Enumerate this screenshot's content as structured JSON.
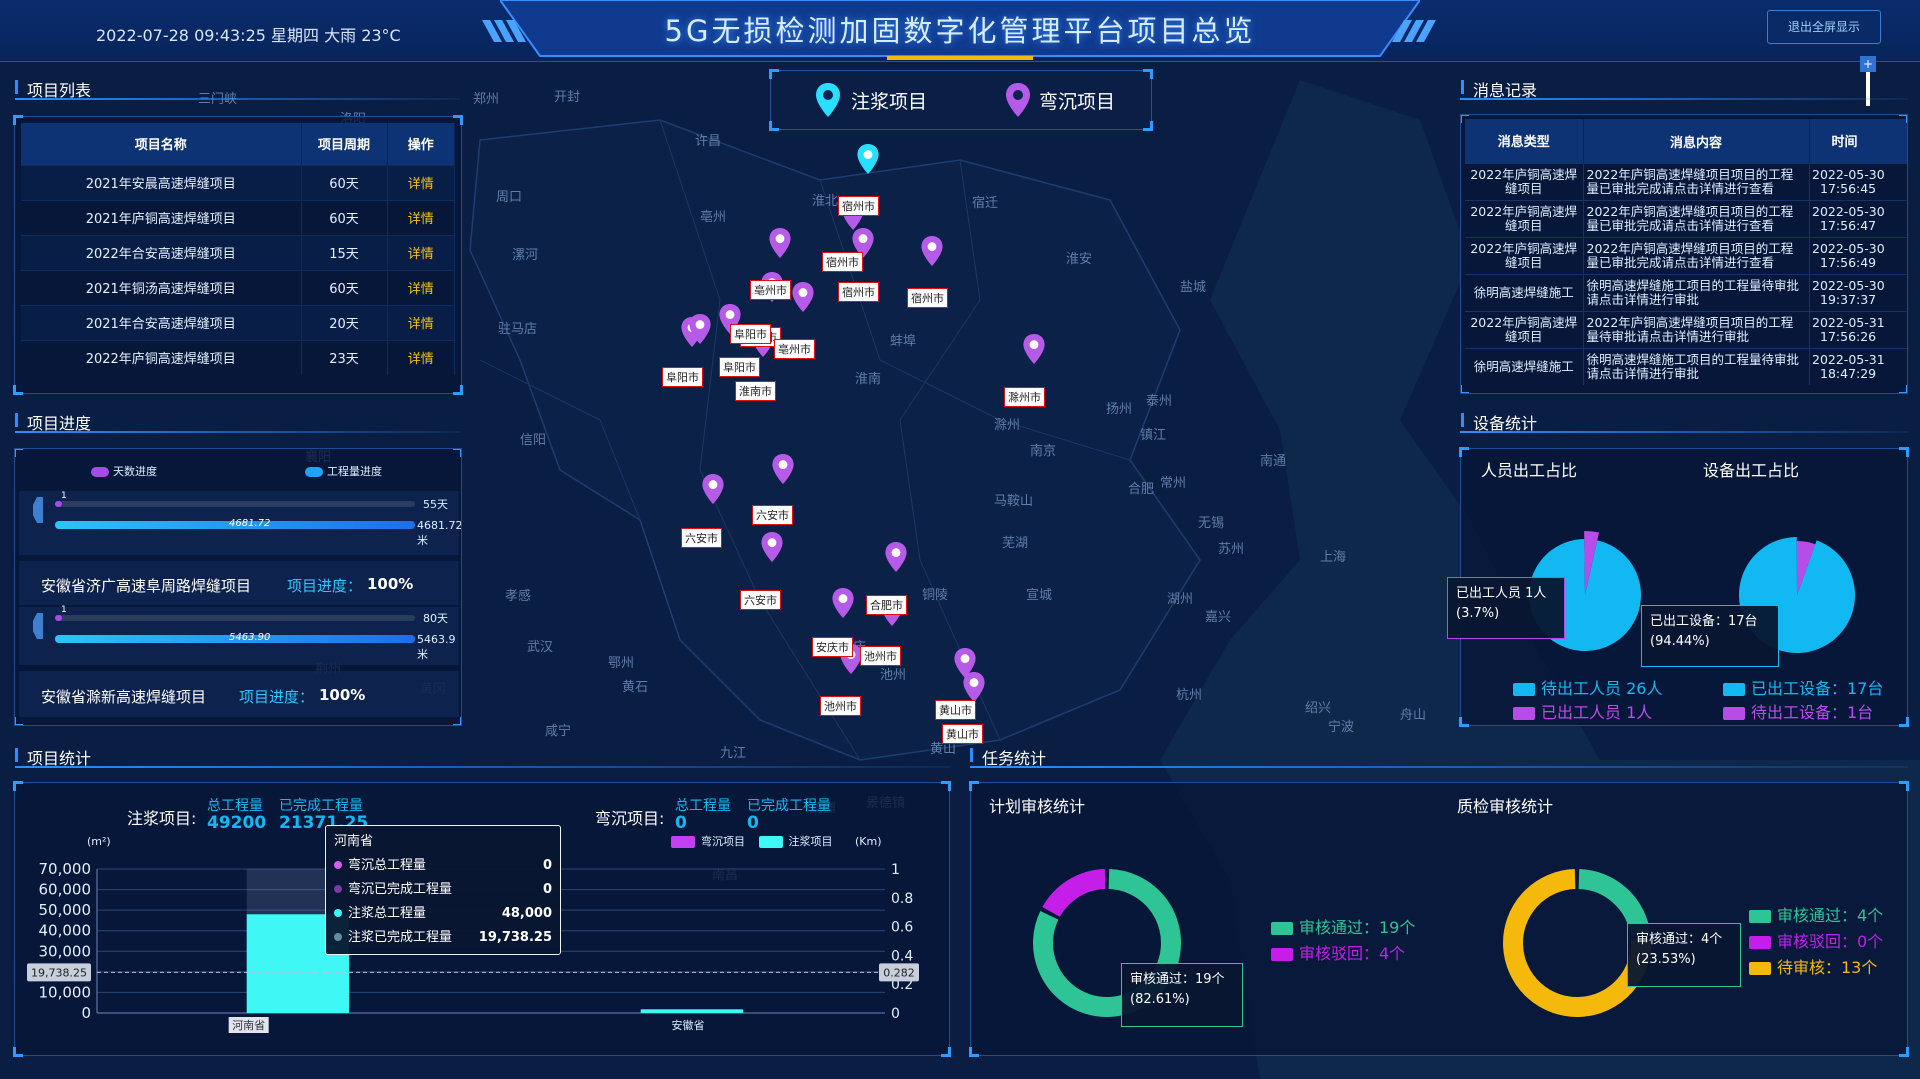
{
  "header": {
    "title": "5G无损检测加固数字化管理平台项目总览",
    "datetime": "2022-07-28 09:43:25 星期四 大雨 23°C",
    "exit_label": "退出全屏显示"
  },
  "map": {
    "legend": {
      "grouting": "注浆项目",
      "bending": "弯沉项目"
    },
    "cities": [
      "郑州",
      "开封",
      "许昌",
      "周口",
      "漯河",
      "驻马店",
      "信阳",
      "亳州",
      "淮北",
      "宿迁",
      "淮安",
      "盐城",
      "蚌埠",
      "淮南",
      "滁州",
      "扬州",
      "泰州",
      "南京",
      "镇江",
      "合肥",
      "马鞍山",
      "常州",
      "南通",
      "无锡",
      "苏州",
      "上海",
      "芜湖",
      "宣城",
      "湖州",
      "嘉兴",
      "杭州",
      "宁波",
      "舟山",
      "绍兴",
      "铜陵",
      "孝感",
      "武汉",
      "鄂州",
      "黄石",
      "咸宁",
      "九江",
      "安庆",
      "池州",
      "黄山",
      "三门峡",
      "洛阳",
      "襄阳",
      "荆州",
      "景德镇",
      "南昌",
      "黄冈",
      "鹰潭"
    ],
    "labels": [
      "宿州市",
      "宿州市",
      "宿州市",
      "宿州市",
      "亳州市",
      "亳州市",
      "亳州市",
      "阜阳市",
      "阜阳市",
      "阜阳市",
      "淮南市",
      "滁州市",
      "六安市",
      "六安市",
      "六安市",
      "合肥市",
      "安庆市",
      "池州市",
      "池州市",
      "黄山市",
      "黄山市"
    ]
  },
  "project_list": {
    "title": "项目列表",
    "columns": [
      "项目名称",
      "项目周期",
      "操作"
    ],
    "rows": [
      {
        "name": "2021年安晨高速焊缝项目",
        "period": "60天",
        "op": "详情"
      },
      {
        "name": "2021年庐铜高速焊缝项目",
        "period": "60天",
        "op": "详情"
      },
      {
        "name": "2022年合安高速焊缝项目",
        "period": "15天",
        "op": "详情"
      },
      {
        "name": "2021年铜汤高速焊缝项目",
        "period": "60天",
        "op": "详情"
      },
      {
        "name": "2021年合安高速焊缝项目",
        "period": "20天",
        "op": "详情"
      },
      {
        "name": "2022年庐铜高速焊缝项目",
        "period": "23天",
        "op": "详情"
      }
    ]
  },
  "progress": {
    "title": "项目进度",
    "legend_days": "天数进度",
    "legend_work": "工程量进度",
    "items": [
      {
        "name": "",
        "label": "",
        "pct": "",
        "day_value": "1",
        "day_total": "55天",
        "day_ratio": 0.02,
        "work_value": "4681.72",
        "work_total": "4681.72米",
        "work_ratio": 1.0
      },
      {
        "name": "安徽省济广高速阜周路焊缝项目",
        "label": "项目进度：",
        "pct": "100%",
        "day_value": "1",
        "day_total": "80天",
        "day_ratio": 0.02,
        "work_value": "5463.90",
        "work_total": "5463.9米",
        "work_ratio": 1.0
      },
      {
        "name": "安徽省滁新高速焊缝项目",
        "label": "项目进度：",
        "pct": "100%"
      }
    ]
  },
  "messages": {
    "title": "消息记录",
    "columns": [
      "消息类型",
      "消息内容",
      "时间"
    ],
    "rows": [
      {
        "type": "2022年庐铜高速焊缝项目",
        "content": "2022年庐铜高速焊缝项目项目的工程量已审批完成请点击详情进行查看",
        "date": "2022-05-30",
        "time": "17:56:45"
      },
      {
        "type": "2022年庐铜高速焊缝项目",
        "content": "2022年庐铜高速焊缝项目项目的工程量已审批完成请点击详情进行查看",
        "date": "2022-05-30",
        "time": "17:56:47"
      },
      {
        "type": "2022年庐铜高速焊缝项目",
        "content": "2022年庐铜高速焊缝项目项目的工程量已审批完成请点击详情进行查看",
        "date": "2022-05-30",
        "time": "17:56:49"
      },
      {
        "type": "徐明高速焊缝施工",
        "content": "徐明高速焊缝施工项目的工程量待审批请点击详情进行审批",
        "date": "2022-05-30",
        "time": "19:37:37"
      },
      {
        "type": "2022年庐铜高速焊缝项目",
        "content": "2022年庐铜高速焊缝项目项目的工程量待审批请点击详情进行审批",
        "date": "2022-05-31",
        "time": "17:56:26"
      },
      {
        "type": "徐明高速焊缝施工",
        "content": "徐明高速焊缝施工项目的工程量待审批请点击详情进行审批",
        "date": "2022-05-31",
        "time": "18:47:29"
      }
    ]
  },
  "device_stats": {
    "title": "设备统计",
    "people_title": "人员出工占比",
    "device_title": "设备出工占比",
    "people_tip": "已出工人员 1人",
    "people_tip_pct": "(3.7%)",
    "device_tip": "已出工设备：17台",
    "device_tip_pct": "(94.44%)",
    "legend": [
      "待出工人员 26人",
      "已出工人员 1人",
      "已出工设备：17台",
      "待出工设备：1台"
    ],
    "colors": {
      "cyan": "#12b8f2",
      "purple": "#b84ce8"
    }
  },
  "project_stats": {
    "title": "项目统计",
    "grouting_label": "注浆项目:",
    "bending_label": "弯沉项目:",
    "total_label": "总工程量",
    "done_label": "已完成工程量",
    "grouting_total": "49200",
    "grouting_done": "21371.25",
    "bending_total": "0",
    "bending_done": "0",
    "chart_legend_bending": "弯沉项目",
    "chart_legend_grouting": "注浆项目",
    "unit_left": "(m²)",
    "unit_right": "(Km)",
    "pointer_left": "19,738.25",
    "pointer_right": "0.282",
    "tooltip": {
      "title": "河南省",
      "rows": [
        {
          "label": "弯沉总工程量",
          "value": "0",
          "color": "#d65cf0"
        },
        {
          "label": "弯沉已完成工程量",
          "value": "0",
          "color": "#7a3aa8"
        },
        {
          "label": "注浆总工程量",
          "value": "48,000",
          "color": "#3ff7f5"
        },
        {
          "label": "注浆已完成工程量",
          "value": "19,738.25",
          "color": "#5f8fa0"
        }
      ]
    }
  },
  "task_stats": {
    "title": "任务统计",
    "plan_title": "计划审核统计",
    "qc_title": "质检审核统计",
    "plan_legend": [
      "审核通过：19个",
      "审核驳回：4个"
    ],
    "plan_tip": "审核通过：19个",
    "plan_tip_pct": "(82.61%)",
    "qc_legend": [
      "审核通过：4个",
      "审核驳回：0个",
      "待审核：13个"
    ],
    "qc_tip": "审核通过：4个",
    "qc_tip_pct": "(23.53%)"
  },
  "chart_data": [
    {
      "type": "bar",
      "title": "",
      "categories": [
        "河南省",
        "安徽省"
      ],
      "xlabel": "",
      "ylabel": "(m²)",
      "ylim": [
        0,
        70000
      ],
      "yticks": [
        "0",
        "10,000",
        "20,000",
        "30,000",
        "40,000",
        "50,000",
        "60,000",
        "70,000"
      ],
      "y2ticks": [
        "0",
        "0.2",
        "0.4",
        "0.6",
        "0.8",
        "1"
      ],
      "series": [
        {
          "name": "注浆项目",
          "values": [
            48000,
            1800
          ]
        },
        {
          "name": "弯沉项目",
          "values": [
            0,
            0
          ]
        }
      ]
    },
    {
      "type": "pie",
      "title": "人员出工占比",
      "labels": [
        "待出工人员",
        "已出工人员"
      ],
      "values": [
        26,
        1
      ]
    },
    {
      "type": "pie",
      "title": "设备出工占比",
      "labels": [
        "已出工设备",
        "待出工设备"
      ],
      "values": [
        17,
        1
      ]
    },
    {
      "type": "pie",
      "title": "计划审核统计",
      "labels": [
        "审核通过",
        "审核驳回"
      ],
      "values": [
        19,
        4
      ]
    },
    {
      "type": "pie",
      "title": "质检审核统计",
      "labels": [
        "审核通过",
        "审核驳回",
        "待审核"
      ],
      "values": [
        4,
        0,
        13
      ]
    }
  ]
}
